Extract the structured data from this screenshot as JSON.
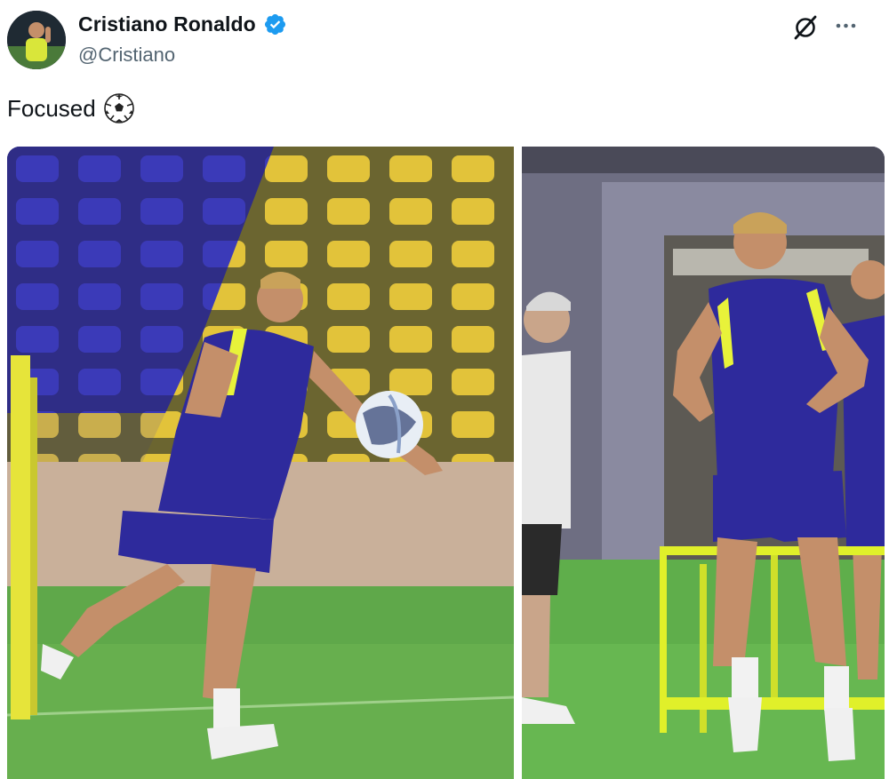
{
  "author": {
    "display_name": "Cristiano Ronaldo",
    "handle": "@Cristiano",
    "verified": true,
    "verified_icon": "verified-badge-icon",
    "avatar_icon": "avatar"
  },
  "actions": {
    "grok_icon": "grok-icon",
    "more_icon": "more-options-icon"
  },
  "tweet": {
    "text": "Focused",
    "emoji": "soccer-ball-emoji"
  },
  "media": [
    {
      "name": "photo-kicking-ball"
    },
    {
      "name": "photo-running-drill"
    }
  ],
  "colors": {
    "verified_blue": "#1d9bf0",
    "text_primary": "#0f1419",
    "text_secondary": "#536471",
    "kit_blue": "#2e2a9c",
    "kit_yellow": "#e8f23a",
    "pitch_green": "#5fa84a"
  }
}
